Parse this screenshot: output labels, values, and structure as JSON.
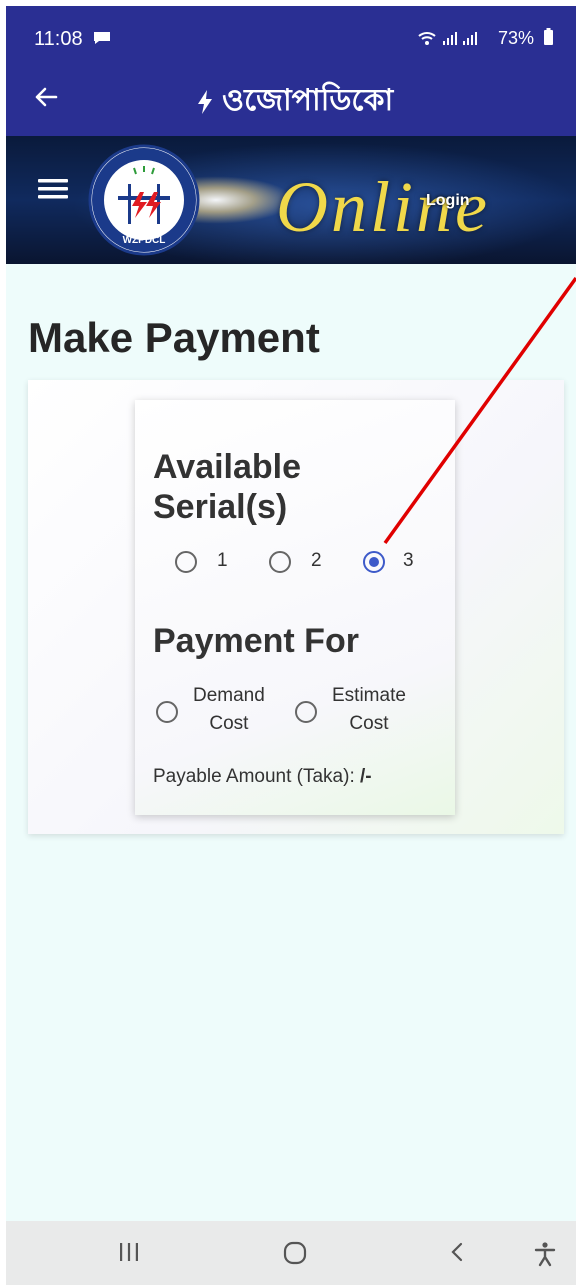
{
  "status_bar": {
    "time": "11:08",
    "battery": "73%",
    "icons": [
      "message-icon",
      "wifi-icon",
      "signal-icon",
      "signal-icon",
      "battery-icon"
    ]
  },
  "app_bar": {
    "title": "ওজোপাডিকো",
    "icons": [
      "back-arrow-icon",
      "lightning-icon"
    ]
  },
  "banner": {
    "logo_text": "WZPDCL",
    "online_text": "Online",
    "login_label": "Login",
    "icons": [
      "menu-icon"
    ]
  },
  "page": {
    "title": "Make Payment"
  },
  "form": {
    "serials_heading": "Available Serial(s)",
    "serial_options": [
      {
        "label": "1",
        "checked": false
      },
      {
        "label": "2",
        "checked": false
      },
      {
        "label": "3",
        "checked": true
      }
    ],
    "payment_heading": "Payment For",
    "payment_options": [
      {
        "line1": "Demand",
        "line2": "Cost",
        "checked": false
      },
      {
        "line1": "Estimate",
        "line2": "Cost",
        "checked": false
      }
    ],
    "payable_label": "Payable Amount (Taka):",
    "payable_value": "/-"
  },
  "nav_bar": {
    "icons": [
      "recent-apps-icon",
      "home-icon",
      "back-icon",
      "accessibility-icon"
    ]
  },
  "colors": {
    "app_bar": "#2a2f93",
    "page_bg": "#eefcfb",
    "radio_selected": "#3d5ac9",
    "annotation_line": "#e00000"
  }
}
